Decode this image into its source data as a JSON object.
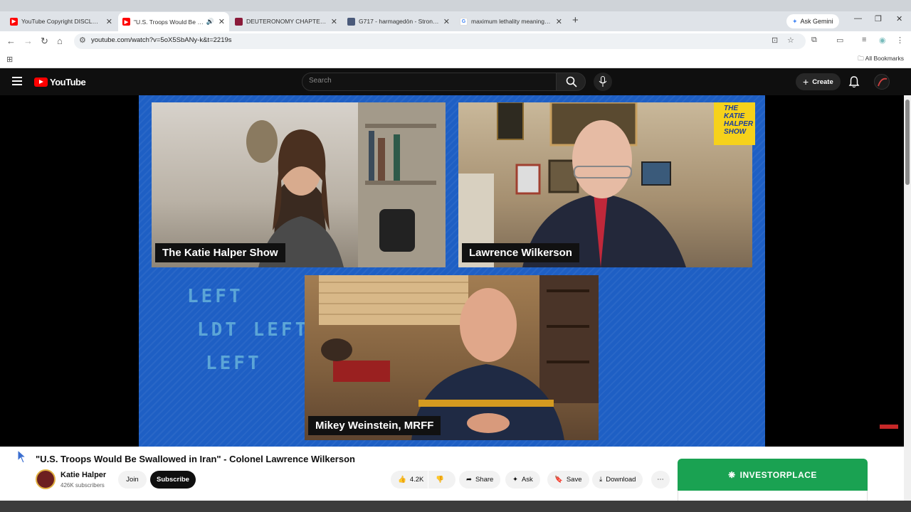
{
  "browser": {
    "tabs": [
      {
        "title": "YouTube Copyright DISCLAIME",
        "color": "#ff0000"
      },
      {
        "title": "\"U.S. Troops Would Be Swal",
        "color": "#ff0000"
      },
      {
        "title": "DEUTERONOMY CHAPTER 28 K",
        "color": "#8b1a3a"
      },
      {
        "title": "G717 - harmagedōn - Strong's",
        "color": "#4a5a7a"
      },
      {
        "title": "maximum lethality meaning - G",
        "color": "#4285f4"
      }
    ],
    "gemini_label": "Ask Gemini",
    "url": "youtube.com/watch?v=5oX5SbANy-k&t=2219s",
    "bookmarks_label": "All Bookmarks"
  },
  "youtube": {
    "logo_text": "YouTube",
    "search_placeholder": "Search",
    "create_label": "Create"
  },
  "video": {
    "captions": {
      "host": "The Katie Halper Show",
      "guest1": "Lawrence Wilkerson",
      "guest2": "Mikey Weinstein, MRFF"
    },
    "show_logo": "THE\nKATIE\nHALPER\nSHOW",
    "bg_text": [
      "LEFT",
      "LDT LEFT",
      "LEFT"
    ]
  },
  "details": {
    "title": "\"U.S. Troops Would Be Swallowed in Iran\" - Colonel Lawrence Wilkerson",
    "channel": "Katie Halper",
    "subscribers": "426K subscribers",
    "join": "Join",
    "subscribe": "Subscribe",
    "likes": "4.2K",
    "share": "Share",
    "ask": "Ask",
    "save": "Save",
    "download": "Download"
  },
  "ad": {
    "brand": "INVESTORPLACE",
    "color": "#1aa252"
  }
}
